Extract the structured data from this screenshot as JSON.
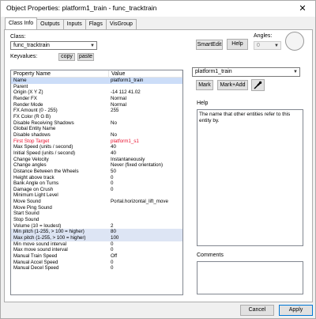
{
  "window": {
    "title": "Object Properties: platform1_train - func_tracktrain",
    "close_glyph": "✕"
  },
  "tabs": [
    {
      "label": "Class Info",
      "active": true
    },
    {
      "label": "Outputs"
    },
    {
      "label": "Inputs"
    },
    {
      "label": "Flags"
    },
    {
      "label": "VisGroup"
    }
  ],
  "class_section": {
    "class_label": "Class:",
    "class_value": "func_tracktrain",
    "keyvalues_label": "Keyvalues:",
    "copy_label": "copy",
    "paste_label": "paste"
  },
  "toolbar": {
    "smartedit_label": "SmartEdit",
    "help_label": "Help",
    "angles_label": "Angles:",
    "angles_value": "0"
  },
  "grid": {
    "col_name": "Property Name",
    "col_value": "Value",
    "rows": [
      {
        "k": "Name",
        "v": "platform1_train",
        "sel": true
      },
      {
        "k": "Parent",
        "v": ""
      },
      {
        "k": "Origin (X Y Z)",
        "v": "-14 112 41.02"
      },
      {
        "k": "Render FX",
        "v": "Normal"
      },
      {
        "k": "Render Mode",
        "v": "Normal"
      },
      {
        "k": "FX Amount (0 - 255)",
        "v": "255"
      },
      {
        "k": "FX Color (R G B)",
        "v": ""
      },
      {
        "k": "Disable Receiving Shadows",
        "v": "No"
      },
      {
        "k": "Global Entity Name",
        "v": ""
      },
      {
        "k": "Disable shadows",
        "v": "No"
      },
      {
        "k": "First Stop Target",
        "v": "platform1_s1",
        "red": true
      },
      {
        "k": "Max Speed (units / second)",
        "v": "40"
      },
      {
        "k": "Initial Speed (units / second)",
        "v": "40"
      },
      {
        "k": "Change Velocity",
        "v": "Instantaneously"
      },
      {
        "k": "Change angles",
        "v": "Never (fixed orientation)"
      },
      {
        "k": "Distance Between the Wheels",
        "v": "50"
      },
      {
        "k": "Height above track",
        "v": "0"
      },
      {
        "k": "Bank Angle on Turns",
        "v": "0"
      },
      {
        "k": "Damage on Crush",
        "v": "0"
      },
      {
        "k": "Minimum Light Level",
        "v": ""
      },
      {
        "k": "Move Sound",
        "v": "Portal.horizontal_lift_move"
      },
      {
        "k": "Move Ping Sound",
        "v": ""
      },
      {
        "k": "Start Sound",
        "v": ""
      },
      {
        "k": "Stop Sound",
        "v": ""
      },
      {
        "k": "Volume (10 = loudest)",
        "v": "2"
      },
      {
        "k": "Min pitch (1-255, > 100 = higher)",
        "v": "80",
        "hl": true
      },
      {
        "k": "Max pitch (1-255, > 100 = higher)",
        "v": "100",
        "hl": true
      },
      {
        "k": "Min move sound interval",
        "v": "0"
      },
      {
        "k": "Max move sound interval",
        "v": "0"
      },
      {
        "k": "Manual Train Speed",
        "v": "Off"
      },
      {
        "k": "Manual Accel Speed",
        "v": "0"
      },
      {
        "k": "Manual Decel Speed",
        "v": "0"
      }
    ]
  },
  "right_panel": {
    "name_value": "platform1_train",
    "mark_label": "Mark",
    "mark_add_label": "Mark+Add",
    "help_label": "Help",
    "help_text": "The name that other entities refer to this entity by.",
    "comments_label": "Comments"
  },
  "footer": {
    "cancel_label": "Cancel",
    "apply_label": "Apply"
  }
}
